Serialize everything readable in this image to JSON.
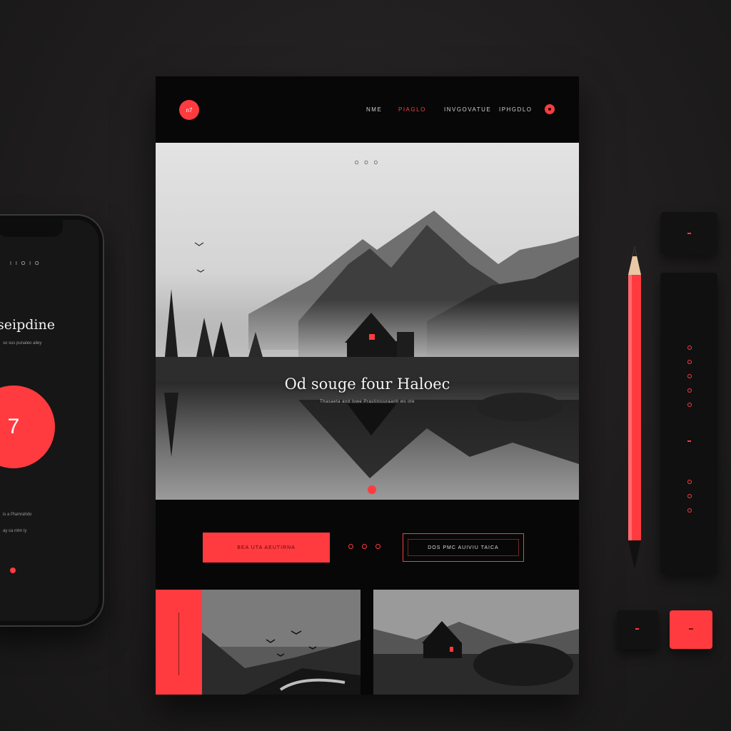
{
  "colors": {
    "accent": "#ff3b3f",
    "page_bg": "#070707",
    "desk_bg": "#1f1d1d"
  },
  "phone": {
    "status_text": "I I O I O",
    "title": "seipdine",
    "subtitle": "so sus punaleo ailey",
    "circle_number": "7",
    "footer_line_1": "is a  Ptamrahdo",
    "footer_line_2": "ay  ca mlm ly",
    "footer_icon": "record-icon"
  },
  "page": {
    "logo_text": "n7",
    "nav": [
      {
        "label": "NME",
        "active": false
      },
      {
        "label": "PIAGLO",
        "active": true
      },
      {
        "label": "INVGOVATUE",
        "active": false
      },
      {
        "label": "IPHGDLO",
        "active": false
      }
    ],
    "nav_icon": "record-icon",
    "hero": {
      "kicker": "O O O",
      "title": "Od souge four Haloec",
      "subtitle": "Thasaeta and lowe Prastinicuraanh ws ote"
    },
    "cta_primary": "BEA UTA AEUTIRNA",
    "cta_secondary": "DOS PMC AUIVIU TAICA"
  }
}
